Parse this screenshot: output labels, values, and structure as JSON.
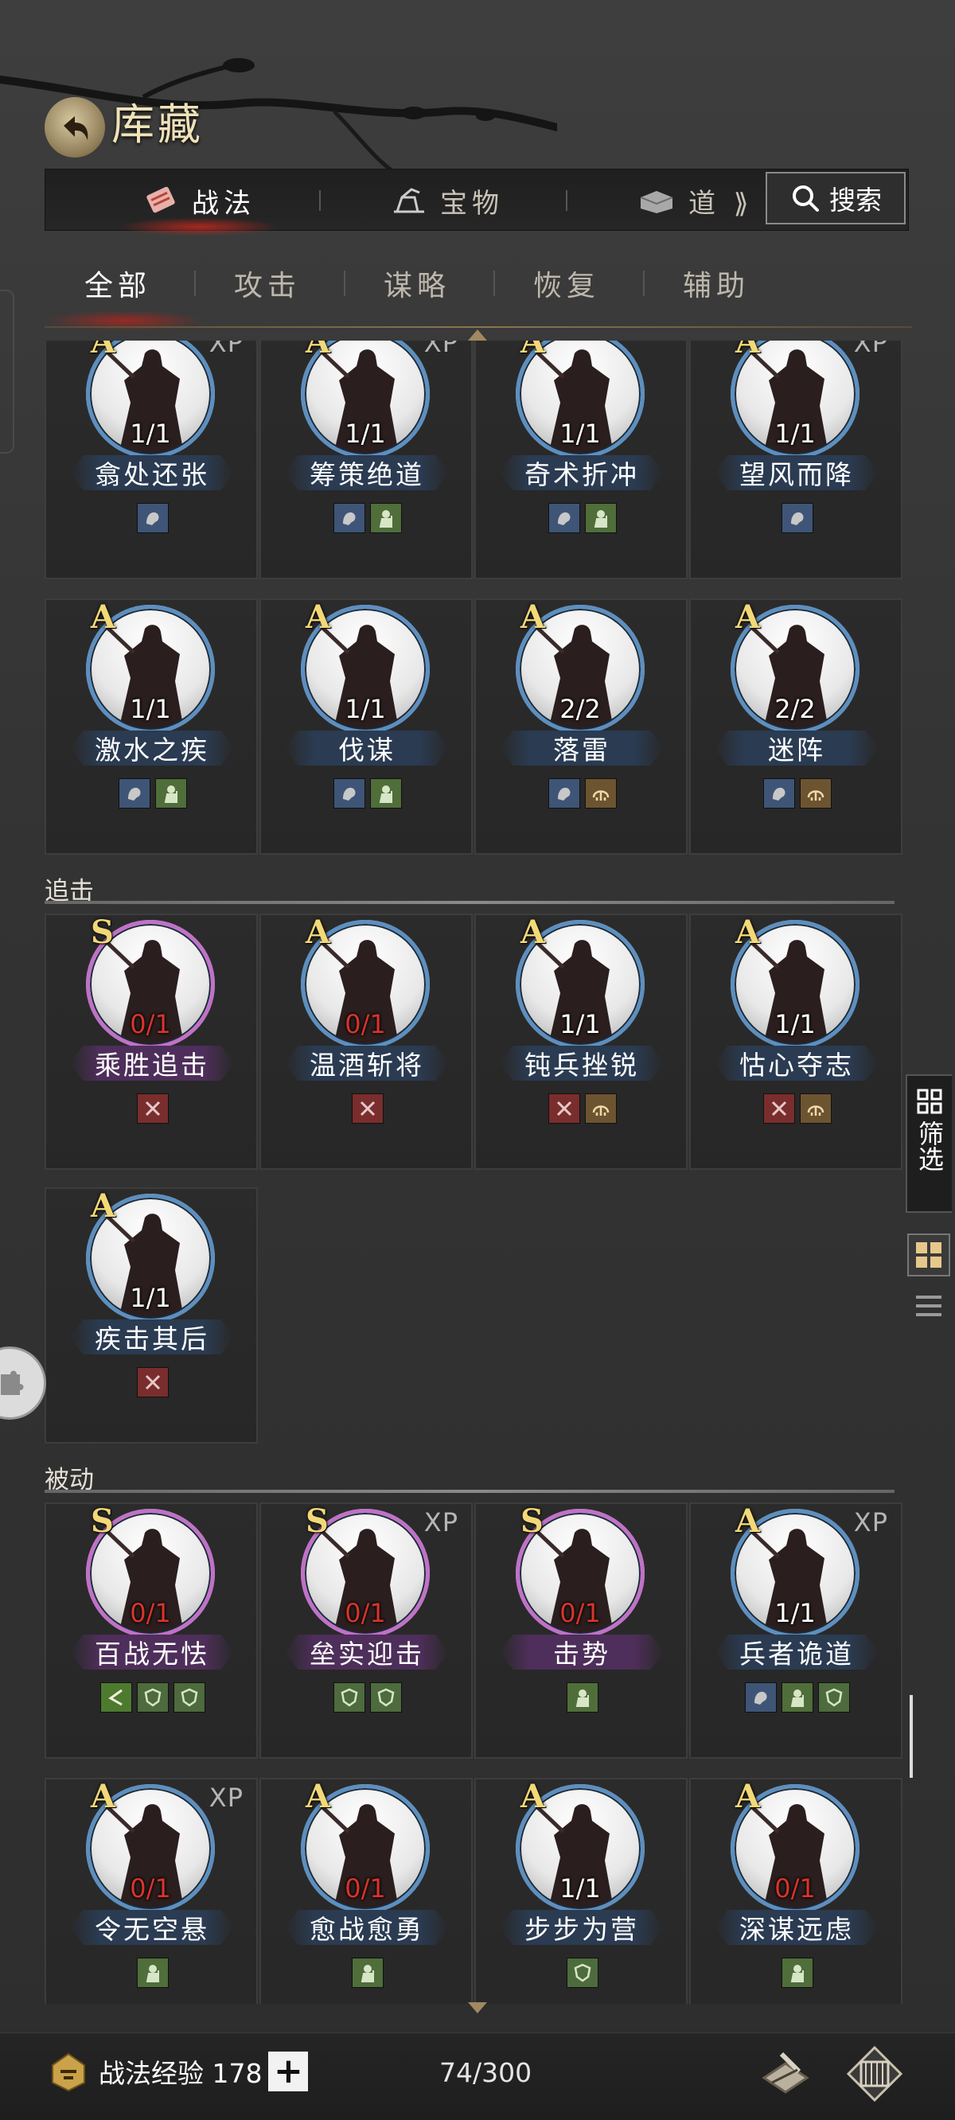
{
  "header": {
    "title": "库藏",
    "back_icon": "back-arrow-icon"
  },
  "tabs": [
    {
      "label": "战法",
      "icon": "tactic-scroll-icon",
      "active": true
    },
    {
      "label": "宝物",
      "icon": "treasure-icon",
      "active": false
    },
    {
      "label": "道具",
      "display": "道 ⟫",
      "icon": "item-chest-icon",
      "active": false
    }
  ],
  "search": {
    "label": "搜索",
    "icon": "search-icon"
  },
  "subtabs": [
    {
      "label": "全部",
      "active": true
    },
    {
      "label": "攻击",
      "active": false
    },
    {
      "label": "谋略",
      "active": false
    },
    {
      "label": "恢复",
      "active": false
    },
    {
      "label": "辅助",
      "active": false
    }
  ],
  "sections": {
    "chase": "追击",
    "passive": "被动"
  },
  "cards": [
    {
      "name": "翕处还张",
      "grade": "A",
      "xp": "XP",
      "count": "1/1",
      "tags": [
        "strat"
      ]
    },
    {
      "name": "筹策绝道",
      "grade": "A",
      "xp": "XP",
      "count": "1/1",
      "tags": [
        "strat",
        "wit"
      ]
    },
    {
      "name": "奇术折冲",
      "grade": "A",
      "xp": "",
      "count": "1/1",
      "tags": [
        "strat",
        "wit"
      ]
    },
    {
      "name": "望风而降",
      "grade": "A",
      "xp": "XP",
      "count": "1/1",
      "tags": [
        "strat"
      ]
    },
    {
      "name": "激水之疾",
      "grade": "A",
      "xp": "",
      "count": "1/1",
      "tags": [
        "strat",
        "wit"
      ]
    },
    {
      "name": "伐谋",
      "grade": "A",
      "xp": "",
      "count": "1/1",
      "tags": [
        "strat",
        "wit"
      ]
    },
    {
      "name": "落雷",
      "grade": "A",
      "xp": "",
      "count": "2/2",
      "tags": [
        "strat",
        "ctl"
      ]
    },
    {
      "name": "迷阵",
      "grade": "A",
      "xp": "",
      "count": "2/2",
      "tags": [
        "strat",
        "ctl"
      ]
    },
    {
      "name": "乘胜追击",
      "grade": "S",
      "xp": "",
      "count": "0/1",
      "tags": [
        "atk"
      ]
    },
    {
      "name": "温酒斩将",
      "grade": "A",
      "xp": "",
      "count": "0/1",
      "tags": [
        "atk"
      ]
    },
    {
      "name": "钝兵挫锐",
      "grade": "A",
      "xp": "",
      "count": "1/1",
      "tags": [
        "atk",
        "ctl"
      ]
    },
    {
      "name": "怙心夺志",
      "grade": "A",
      "xp": "",
      "count": "1/1",
      "tags": [
        "atk",
        "ctl"
      ]
    },
    {
      "name": "疾击其后",
      "grade": "A",
      "xp": "",
      "count": "1/1",
      "tags": [
        "atk"
      ]
    },
    {
      "name": "百战无怯",
      "grade": "S",
      "xp": "",
      "count": "0/1",
      "tags": [
        "gold",
        "def",
        "def"
      ]
    },
    {
      "name": "垒实迎击",
      "grade": "S",
      "xp": "XP",
      "count": "0/1",
      "tags": [
        "def",
        "def"
      ]
    },
    {
      "name": "击势",
      "grade": "S",
      "xp": "",
      "count": "0/1",
      "tags": [
        "wit"
      ]
    },
    {
      "name": "兵者诡道",
      "grade": "A",
      "xp": "XP",
      "count": "1/1",
      "tags": [
        "strat",
        "wit",
        "def"
      ]
    },
    {
      "name": "令无空悬",
      "grade": "A",
      "xp": "XP",
      "count": "0/1",
      "tags": [
        "wit"
      ]
    },
    {
      "name": "愈战愈勇",
      "grade": "A",
      "xp": "",
      "count": "0/1",
      "tags": [
        "wit"
      ]
    },
    {
      "name": "步步为营",
      "grade": "A",
      "xp": "",
      "count": "1/1",
      "tags": [
        "def"
      ]
    },
    {
      "name": "深谋远虑",
      "grade": "A",
      "xp": "",
      "count": "0/1",
      "tags": [
        "wit"
      ]
    }
  ],
  "side": {
    "filter_label": "筛选"
  },
  "footer": {
    "exp_label": "战法经验 178",
    "plus": "+",
    "page_count": "74/300"
  },
  "colors": {
    "accent_red": "#d8342b",
    "grade_gold": "#f3d878",
    "ring_a": "#5c8fc0",
    "ring_s": "#c071c8"
  }
}
